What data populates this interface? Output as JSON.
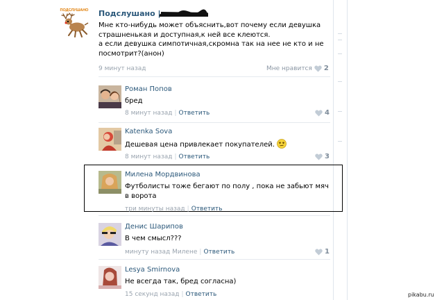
{
  "post": {
    "author": "Подслушано |",
    "logo_text": "ПОДСЛУШАНО",
    "text_lines": [
      "Мне кто-нибудь может объяснить,вот почему если девушка",
      "страшненькая и доступная,к ней все клеются.",
      "а если девушка симпотичная,скромна так на нее не кто и не",
      "посмотрит?(анон)"
    ],
    "time": "9 минут назад",
    "like_label": "Мне нравится",
    "like_count": "2"
  },
  "comments": [
    {
      "author": "Роман Попов",
      "text": "бред",
      "time": "8 минут назад",
      "reply": "Ответить",
      "likes": "4"
    },
    {
      "author": "Katenka Sova",
      "text": "Дешевая цена привлекает покупателей.",
      "time": "8 минут назад",
      "reply": "Ответить",
      "likes": "3"
    },
    {
      "author": "Милена Мордвинова",
      "text": "Футболисты тоже бегают по полу , пока не забьют мяч в ворота",
      "time": "три минуты назад",
      "reply": "Ответить",
      "likes": ""
    },
    {
      "author": "Денис Шарипов",
      "text": "В чем смысл???",
      "time": "минуту назад Милене",
      "reply": "Ответить",
      "likes": "1"
    },
    {
      "author": "Lesya Smirnova",
      "text": "Не всегда так, бред согласна)",
      "time": "15 секунд назад",
      "reply": "Ответить",
      "likes": ""
    }
  ],
  "watermark": "pikabu.ru",
  "colors": {
    "link": "#2b587a",
    "meta": "#9aa4af",
    "heart": "#c2ccd6"
  }
}
